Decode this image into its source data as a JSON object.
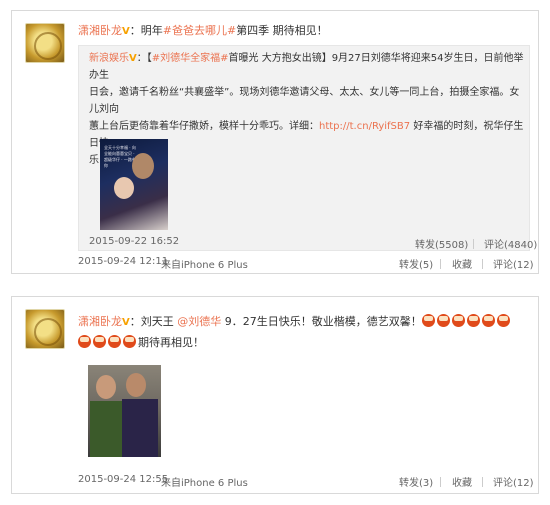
{
  "post1": {
    "user": "潇湘卧龙",
    "text_pre": "：明年",
    "hash1": "#爸爸去哪儿#",
    "text_post": "第四季 期待相见！",
    "repost": {
      "source": "新浪娱乐",
      "hash": "#刘德华全家福#",
      "line1a": "首曝光 大方抱女出镜】9月27日刘德华将迎来54岁生日，日前他举办生",
      "line2": "日会，邀请千名粉丝“共襄盛举”。现场刘德华邀请父母、太太、女儿等一同上台，拍摄全家福。女儿刘向",
      "line3a": "蕙上台后更倚靠着华仔撒娇，模样十分乖巧。详细：",
      "link": "http://t.cn/RyifSB7",
      "line3b": " 好幸福的时刻，祝华仔生日快",
      "line4": "乐！",
      "photo_caption": "全天十分幸福 · 向全能向蕙蕙宝贝 · 超级华仔 · 一路有你",
      "time": "2015-09-22 16:52",
      "forward": "转发(5508)",
      "comment": "评论(4840)"
    },
    "time": "2015-09-24 12:11",
    "source": "来自iPhone 6 Plus",
    "forward": "转发(5)",
    "favorite": "收藏",
    "comment": "评论(12)"
  },
  "post2": {
    "user": "潇湘卧龙",
    "text_a": "：刘天王 ",
    "mention": "@刘德华",
    "text_b": " 9．27生日快乐！敬业楷模，德艺双馨！",
    "text_c": "期待再相见！",
    "time": "2015-09-24 12:55",
    "source": "来自iPhone 6 Plus",
    "forward": "转发(3)",
    "favorite": "收藏",
    "comment": "评论(12)"
  },
  "icons": {
    "cake": "birthday-cake-icon",
    "vip": "vip-badge-icon"
  }
}
